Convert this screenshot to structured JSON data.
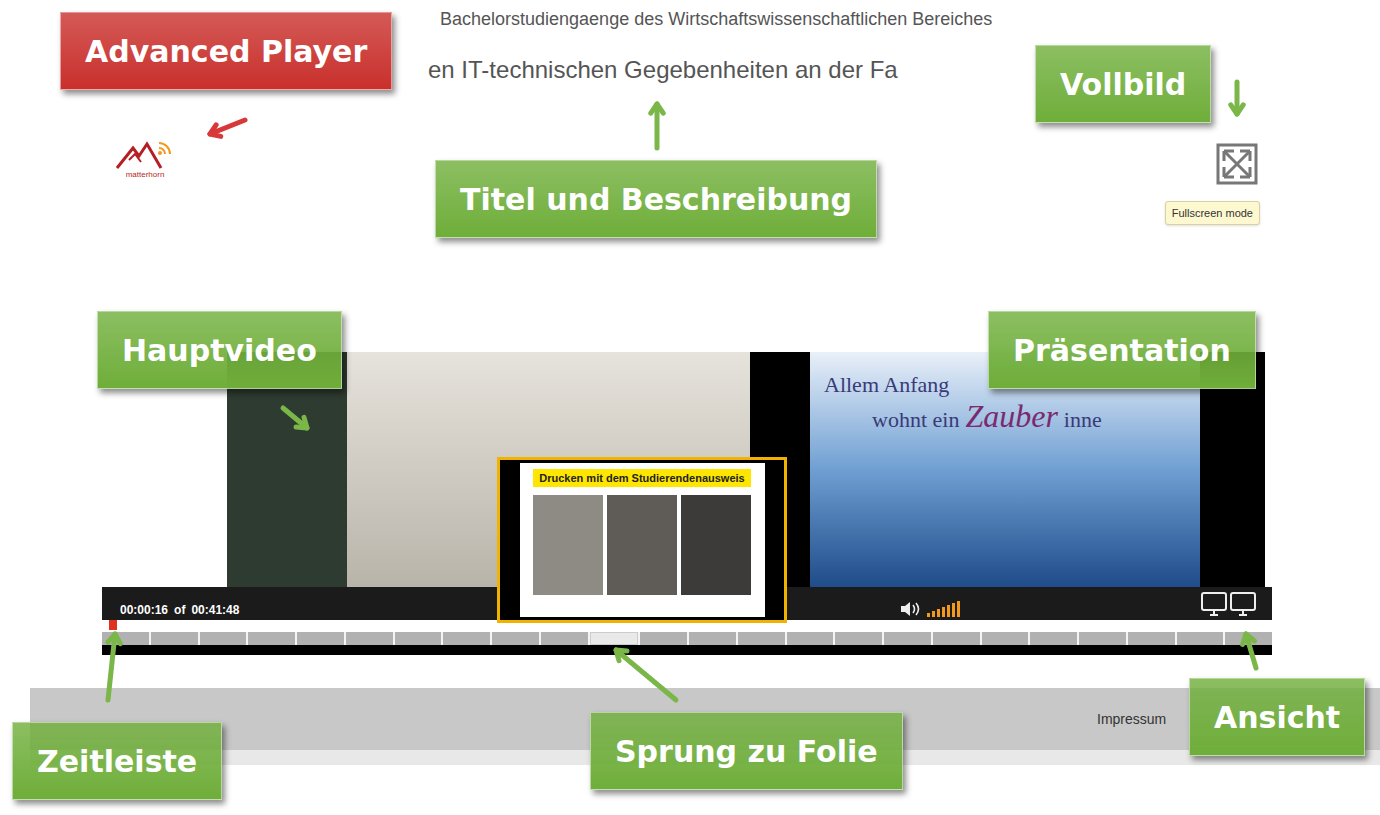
{
  "page": {
    "subtitle": "Bachelorstudiengaenge des Wirtschaftswissenschaftlichen Bereiches",
    "title": "en IT-technischen Gegebenheiten an der Fa",
    "logo": "matterhorn",
    "fullscreen_tooltip": "Fullscreen mode",
    "footer_link": "Impressum"
  },
  "player": {
    "current_time": "00:00:16",
    "separator": "of",
    "total_time": "00:41:48",
    "volume": {
      "level": 1
    },
    "progress": {
      "level": 0.006
    },
    "slide": {
      "line1": "Allem Anfang",
      "line2": [
        {
          "text": "wohnt ein",
          "emphasis": false
        },
        {
          "text": "Zauber",
          "emphasis": true
        },
        {
          "text": "inne",
          "emphasis": false
        }
      ]
    },
    "preview": {
      "title": "Drucken mit dem Studierendenausweis"
    },
    "segments": [
      {
        "selected": false
      },
      {
        "selected": false
      },
      {
        "selected": false
      },
      {
        "selected": false
      },
      {
        "selected": false
      },
      {
        "selected": false
      },
      {
        "selected": false
      },
      {
        "selected": false
      },
      {
        "selected": false
      },
      {
        "selected": false
      },
      {
        "selected": true
      },
      {
        "selected": false
      },
      {
        "selected": false
      },
      {
        "selected": false
      },
      {
        "selected": false
      },
      {
        "selected": false
      },
      {
        "selected": false
      },
      {
        "selected": false
      },
      {
        "selected": false
      },
      {
        "selected": false
      },
      {
        "selected": false
      },
      {
        "selected": false
      },
      {
        "selected": false
      },
      {
        "selected": false
      }
    ]
  },
  "annotations": [
    {
      "text": "Advanced Player",
      "color": "#c9302c"
    },
    {
      "text": "Titel und Beschreibung",
      "color": "#6fae3a"
    },
    {
      "text": "Vollbild",
      "color": "#6fae3a"
    },
    {
      "text": "Hauptvideo",
      "color": "#6fae3a"
    },
    {
      "text": "Präsentation",
      "color": "#6fae3a"
    },
    {
      "text": "Zeitleiste",
      "color": "#6fae3a"
    },
    {
      "text": "Sprung zu Folie",
      "color": "#6fae3a"
    },
    {
      "text": "Ansicht",
      "color": "#6fae3a"
    }
  ]
}
